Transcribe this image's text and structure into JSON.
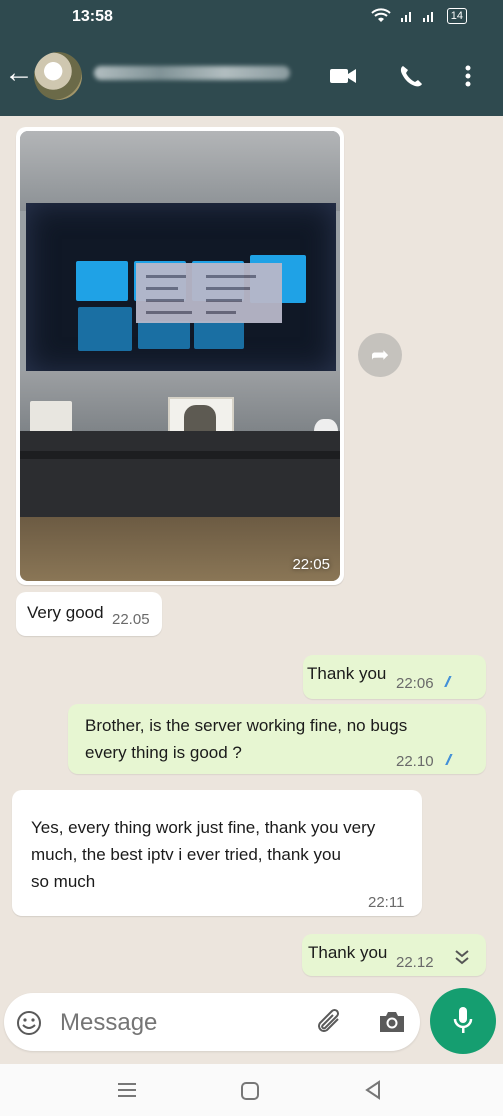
{
  "status_bar": {
    "time": "13:58",
    "battery": "14"
  },
  "header": {
    "back_label": "←"
  },
  "messages": [
    {
      "id": "m1",
      "direction": "in",
      "type": "image",
      "time": "22:05"
    },
    {
      "id": "m2",
      "direction": "in",
      "text": "Very good",
      "time": "22.05"
    },
    {
      "id": "m3",
      "direction": "out",
      "text": "Thank you",
      "time": "22:06",
      "ticks": "//"
    },
    {
      "id": "m4",
      "direction": "out",
      "text": "Brother, is the server working fine, no bugs\nevery thing is good ?",
      "time": "22.10",
      "ticks": "//"
    },
    {
      "id": "m5",
      "direction": "in",
      "text": "Yes, every thing work just fine, thank you very\nmuch, the best iptv i ever tried, thank you\nso much",
      "time": "22:11"
    },
    {
      "id": "m6",
      "direction": "out",
      "text": "Thank you",
      "time": "22.12"
    }
  ],
  "composer": {
    "placeholder": "Message"
  },
  "icons": [
    "wifi-icon",
    "signal-icon",
    "video-call-icon",
    "phone-icon",
    "more-icon",
    "forward-icon",
    "chevron-down-icon",
    "emoji-icon",
    "attach-icon",
    "camera-icon",
    "mic-icon",
    "recents-icon",
    "home-icon",
    "back-nav-icon"
  ],
  "colors": {
    "header": "#2F4A4F",
    "outgoing": "#E7F6D2",
    "incoming": "#FFFFFF",
    "mic": "#159E70",
    "ticks": "#3B8BD8"
  }
}
